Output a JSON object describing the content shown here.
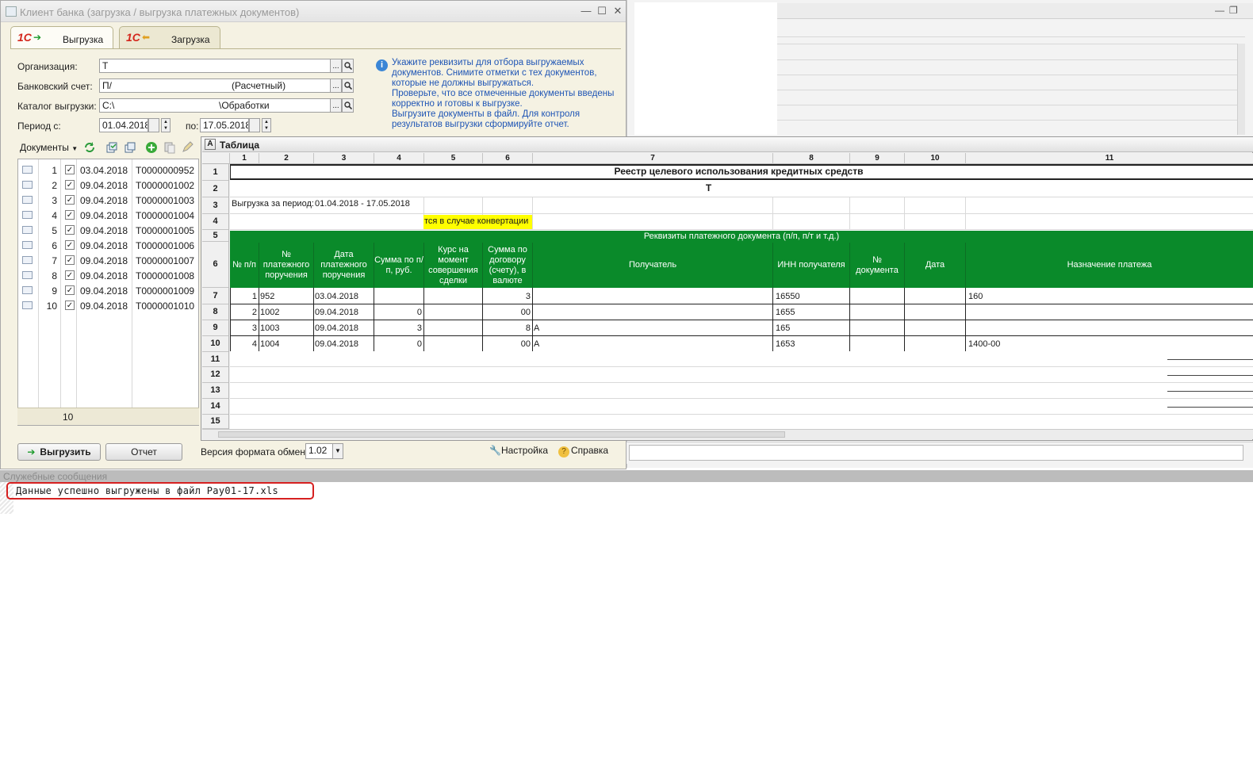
{
  "window": {
    "title": "Клиент банка (загрузка / выгрузка платежных документов)",
    "minimize": "—",
    "maximize": "☐",
    "close": "✕"
  },
  "tabs": [
    {
      "label": "Выгрузка",
      "logo": "1С"
    },
    {
      "label": "Загрузка",
      "logo": "1С"
    }
  ],
  "form": {
    "org_label": "Организация:",
    "org_value": "Т",
    "account_label": "Банковский счет:",
    "account_value": "П/",
    "account_type": "(Расчетный)",
    "catalog_label": "Каталог выгрузки:",
    "catalog_value": "C:\\",
    "catalog_tail": "\\Обработки",
    "period_from_label": "Период с:",
    "period_from_value": "01.04.2018",
    "period_to_label": "по:",
    "period_to_value": "17.05.2018",
    "dots": "..."
  },
  "info": {
    "icon": "i",
    "lines": [
      "Укажите реквизиты для отбора выгружаемых",
      "документов. Снимите отметки с тех документов,",
      "которые не должны выгружаться.",
      "Проверьте, что все отмеченные документы введены",
      "корректно и готовы к выгрузке.",
      "Выгрузите документы в файл. Для контроля",
      "результатов выгрузки сформируйте отчет."
    ]
  },
  "toolbar": {
    "documents_menu": "Документы"
  },
  "documents": [
    {
      "n": "1",
      "date": "03.04.2018",
      "code": "T0000000952",
      "checked": "✓"
    },
    {
      "n": "2",
      "date": "09.04.2018",
      "code": "T0000001002",
      "checked": "✓"
    },
    {
      "n": "3",
      "date": "09.04.2018",
      "code": "T0000001003",
      "checked": "✓"
    },
    {
      "n": "4",
      "date": "09.04.2018",
      "code": "T0000001004",
      "checked": "✓"
    },
    {
      "n": "5",
      "date": "09.04.2018",
      "code": "T0000001005",
      "checked": "✓"
    },
    {
      "n": "6",
      "date": "09.04.2018",
      "code": "T0000001006",
      "checked": "✓"
    },
    {
      "n": "7",
      "date": "09.04.2018",
      "code": "T0000001007",
      "checked": "✓"
    },
    {
      "n": "8",
      "date": "09.04.2018",
      "code": "T0000001008",
      "checked": "✓"
    },
    {
      "n": "9",
      "date": "09.04.2018",
      "code": "T0000001009",
      "checked": "✓"
    },
    {
      "n": "10",
      "date": "09.04.2018",
      "code": "T0000001010",
      "checked": "✓"
    }
  ],
  "documents_count": "10",
  "buttons": {
    "export": "Выгрузить",
    "report": "Отчет",
    "settings": "Настройка",
    "help": "Справка"
  },
  "format": {
    "label": "Версия формата обмена:",
    "value": "1.02"
  },
  "table_window": {
    "title": "Таблица",
    "col_headers": [
      "1",
      "2",
      "3",
      "4",
      "5",
      "6",
      "7",
      "8",
      "9",
      "10",
      "11"
    ],
    "row_headers": [
      "1",
      "2",
      "3",
      "4",
      "5",
      "6",
      "7",
      "8",
      "9",
      "10",
      "11",
      "12",
      "13",
      "14",
      "15"
    ],
    "report_title": "Реестр целевого использования кредитных средств",
    "org": "Т",
    "period_label": "Выгрузка за период:",
    "period_value": "01.04.2018  - 17.05.2018",
    "yellow_note": "тся в случае конвертации",
    "group_header": "Реквизиты платежного документа (п/п, п/т и т.д.)",
    "headers": [
      "№ п/п",
      "№ платежного поручения",
      "Дата платежного поручения",
      "Сумма по п/п, руб.",
      "Курс на момент совершения сделки",
      "Сумма по договору (счету), в валюте",
      "Получатель",
      "ИНН получателя",
      "№ документа",
      "Дата",
      "Назначение платежа"
    ],
    "rows": [
      {
        "n": "1",
        "pp": "952",
        "date": "03.04.2018",
        "sum": "",
        "amt": "3",
        "recv": "",
        "inn": "16550",
        "purpose": "160"
      },
      {
        "n": "2",
        "pp": "1002",
        "date": "09.04.2018",
        "sum": "0",
        "amt": "00",
        "recv": "",
        "inn": "1655",
        "purpose": ""
      },
      {
        "n": "3",
        "pp": "1003",
        "date": "09.04.2018",
        "sum": "3",
        "amt": "8",
        "recv": "А",
        "inn": "165",
        "purpose": ""
      },
      {
        "n": "4",
        "pp": "1004",
        "date": "09.04.2018",
        "sum": "0",
        "amt": "00",
        "recv": "А",
        "inn": "1653",
        "purpose": "1400-00"
      }
    ]
  },
  "messages": {
    "header": "Служебные сообщения",
    "text": "Данные успешно выгружены в файл Pay01-17.xls"
  }
}
